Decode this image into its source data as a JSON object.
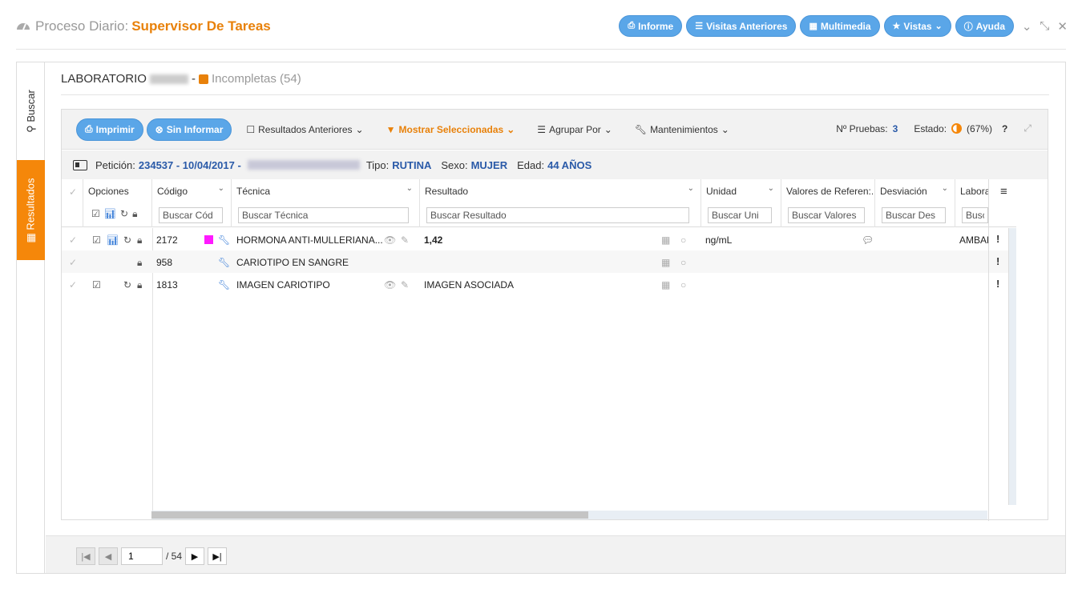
{
  "header": {
    "title_prefix": "Proceso Diario:",
    "title_accent": "Supervisor De Tareas",
    "buttons": [
      "Informe",
      "Visitas Anteriores",
      "Multimedia",
      "Vistas",
      "Ayuda"
    ]
  },
  "tabs": {
    "buscar": "Buscar",
    "resultados": "Resultados"
  },
  "lab": {
    "name": "LABORATORIO",
    "separator": "-",
    "status": "Incompletas (54)"
  },
  "toolbar": {
    "imprimir": "Imprimir",
    "sin_informar": "Sin Informar",
    "resultados_anteriores": "Resultados Anteriores",
    "mostrar_seleccionadas": "Mostrar Seleccionadas",
    "agrupar_por": "Agrupar Por",
    "mantenimientos": "Mantenimientos",
    "n_pruebas_label": "Nº Pruebas:",
    "n_pruebas_value": "3",
    "estado_label": "Estado:",
    "estado_value": "(67%)",
    "help": "?"
  },
  "patient": {
    "peticion_label": "Petición:",
    "peticion_value": "234537 - 10/04/2017 -",
    "tipo_label": "Tipo:",
    "tipo_value": "RUTINA",
    "sexo_label": "Sexo:",
    "sexo_value": "MUJER",
    "edad_label": "Edad:",
    "edad_value": "44 AÑOS"
  },
  "columns": {
    "opciones": "Opciones",
    "codigo": "Código",
    "tecnica": "Técnica",
    "resultado": "Resultado",
    "unidad": "Unidad",
    "valores": "Valores de Referen:.",
    "desviacion": "Desviación",
    "laboratorio": "Labora"
  },
  "filters": {
    "codigo": "Buscar Cód",
    "tecnica": "Buscar Técnica",
    "resultado": "Buscar Resultado",
    "unidad": "Buscar Uni",
    "valores": "Buscar Valores",
    "desviacion": "Buscar Des",
    "laboratorio": "Busca"
  },
  "rows": [
    {
      "codigo": "2172",
      "tecnica": "HORMONA ANTI-MULLERIANA...",
      "resultado": "1,42",
      "unidad": "ng/mL",
      "laboratorio": "AMBAR"
    },
    {
      "codigo": "958",
      "tecnica": "CARIOTIPO EN SANGRE",
      "resultado": "",
      "unidad": "",
      "laboratorio": ""
    },
    {
      "codigo": "1813",
      "tecnica": "IMAGEN CARIOTIPO",
      "resultado": "IMAGEN ASOCIADA",
      "unidad": "",
      "laboratorio": ""
    }
  ],
  "pager": {
    "page": "1",
    "total": "/ 54"
  },
  "colors": {
    "accent": "#e8810a",
    "primary": "#5aa6e8",
    "value_blue": "#2a5aa8",
    "flag": "#ff1aff"
  }
}
